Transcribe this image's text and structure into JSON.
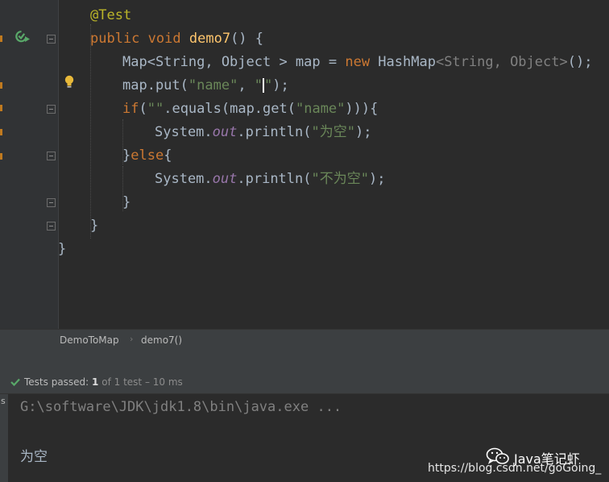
{
  "editor": {
    "lines": {
      "l1": {
        "annotation": "@Test"
      },
      "l2": {
        "kw_public": "public",
        "kw_void": "void",
        "method": "demo7",
        "rest": "() {"
      },
      "l3": {
        "a": "Map<String, Object > map = ",
        "kw_new": "new",
        "b": " HashMap",
        "gen": "<String, Object>",
        "c": "();"
      },
      "l4": {
        "a": "map.put(",
        "s1": "\"name\"",
        "b": ", ",
        "s2a": "\"",
        "s2b": "\"",
        "c": ");"
      },
      "l5": {
        "kw_if": "if",
        "a": "(",
        "s1": "\"\"",
        "b": ".equals(map.get(",
        "s2": "\"name\"",
        "c": "))){"
      },
      "l6": {
        "a": "System.",
        "out": "out",
        "b": ".println(",
        "s": "\"为空\"",
        "c": ");"
      },
      "l7": {
        "a": "}",
        "kw_else": "else",
        "b": "{"
      },
      "l8": {
        "a": "System.",
        "out": "out",
        "b": ".println(",
        "s": "\"不为空\"",
        "c": ");"
      },
      "l9": {
        "a": "}"
      },
      "l10": {
        "a": "}"
      },
      "l11": {
        "a": "}"
      }
    }
  },
  "breadcrumb": {
    "class_name": "DemoToMap",
    "method_name": "demo7()"
  },
  "run_bar": {
    "status_label": "Tests passed:",
    "passed": "1",
    "of_text": "of 1 test",
    "duration": "– 10 ms"
  },
  "console": {
    "command": "G:\\software\\JDK\\jdk1.8\\bin\\java.exe ...",
    "output": "为空",
    "side_label": "s"
  },
  "watermark": {
    "brand": "Java笔记虾",
    "url": "https://blog.csdn.net/goGoing_"
  },
  "icons": {
    "run": "run-test-icon",
    "bulb": "lightbulb-icon",
    "check": "check-icon",
    "wechat": "wechat-icon"
  },
  "colors": {
    "keyword": "#cc7832",
    "string": "#6a8759",
    "annotation": "#bbb529",
    "method": "#ffc66d",
    "pass": "#59a869"
  }
}
